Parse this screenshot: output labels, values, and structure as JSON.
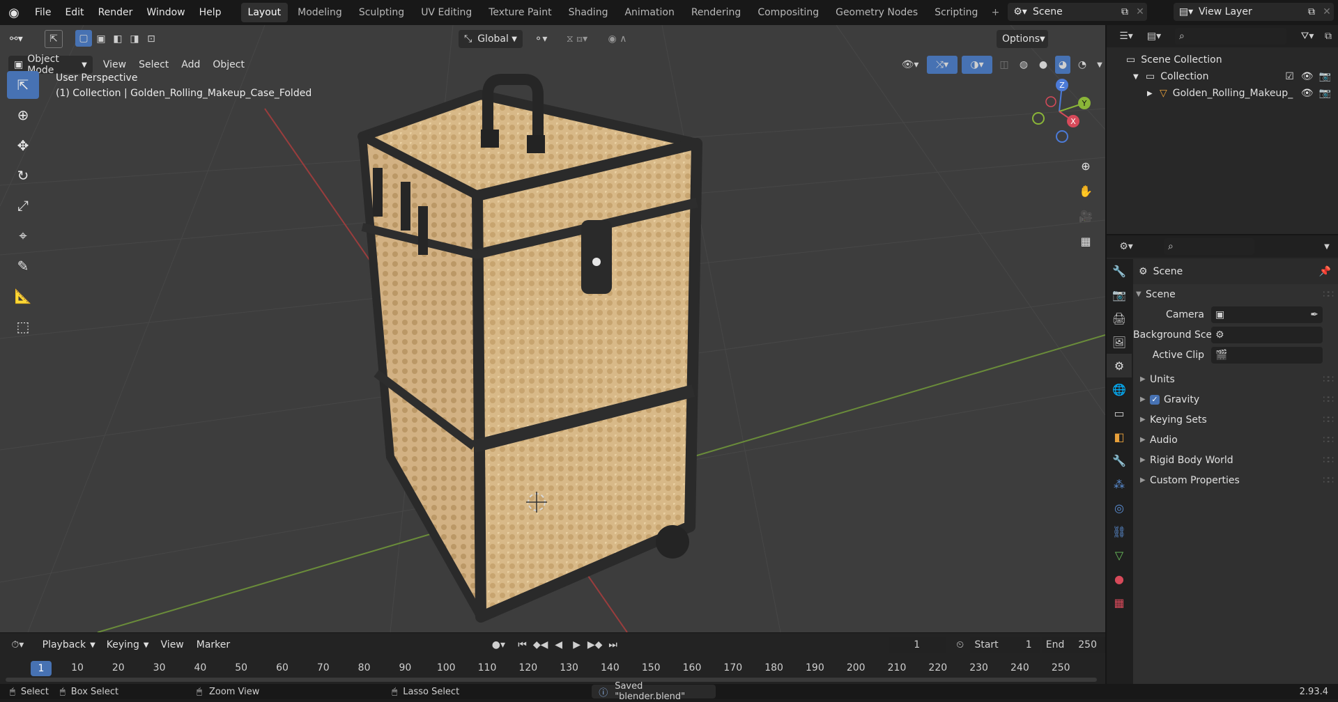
{
  "menu": [
    "File",
    "Edit",
    "Render",
    "Window",
    "Help"
  ],
  "workspaces": [
    "Layout",
    "Modeling",
    "Sculpting",
    "UV Editing",
    "Texture Paint",
    "Shading",
    "Animation",
    "Rendering",
    "Compositing",
    "Geometry Nodes",
    "Scripting"
  ],
  "scene_name": "Scene",
  "view_layer": "View Layer",
  "viewport": {
    "orientation": "Global",
    "options": "Options",
    "mode": "Object Mode",
    "menus": [
      "View",
      "Select",
      "Add",
      "Object"
    ],
    "perspective": "User Perspective",
    "collection_info": "(1) Collection | Golden_Rolling_Makeup_Case_Folded",
    "axis": {
      "x": "X",
      "y": "Y",
      "z": "Z"
    }
  },
  "timeline": {
    "menus": [
      "Playback",
      "Keying",
      "View",
      "Marker"
    ],
    "current_frame": "1",
    "start_label": "Start",
    "start": "1",
    "end_label": "End",
    "end": "250",
    "ticks": [
      "10",
      "20",
      "30",
      "40",
      "50",
      "60",
      "70",
      "80",
      "90",
      "100",
      "110",
      "120",
      "130",
      "140",
      "150",
      "160",
      "170",
      "180",
      "190",
      "200",
      "210",
      "220",
      "230",
      "240",
      "250"
    ],
    "cursor": "1"
  },
  "status": {
    "select": "Select",
    "box_select": "Box Select",
    "zoom_view": "Zoom View",
    "lasso_select": "Lasso Select",
    "message": "Saved \"blender.blend\"",
    "version": "2.93.4"
  },
  "outliner": {
    "root": "Scene Collection",
    "collection": "Collection",
    "object": "Golden_Rolling_Makeup_"
  },
  "properties": {
    "context": "Scene",
    "panel": "Scene",
    "camera_label": "Camera",
    "background_label": "Background Sce...",
    "active_clip_label": "Active Clip",
    "subpanels": [
      "Units",
      "Gravity",
      "Keying Sets",
      "Audio",
      "Rigid Body World",
      "Custom Properties"
    ]
  }
}
